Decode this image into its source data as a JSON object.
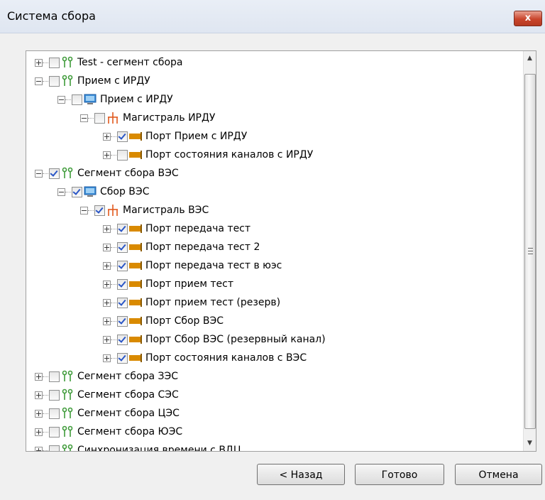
{
  "window": {
    "title": "Система сбора",
    "close_label": "x"
  },
  "tree": {
    "items": [
      {
        "label": "Test - сегмент сбора",
        "level": 0,
        "expander": "plus",
        "checked": false,
        "icon": "segment-icon"
      },
      {
        "label": "Прием с ИРДУ",
        "level": 0,
        "expander": "minus",
        "checked": false,
        "icon": "segment-icon"
      },
      {
        "label": "Прием с ИРДУ",
        "level": 1,
        "expander": "minus",
        "checked": false,
        "icon": "monitor-icon"
      },
      {
        "label": "Магистраль ИРДУ",
        "level": 2,
        "expander": "minus",
        "checked": false,
        "icon": "network-icon"
      },
      {
        "label": "Порт Прием с ИРДУ",
        "level": 3,
        "expander": "plus",
        "checked": true,
        "icon": "port-icon"
      },
      {
        "label": "Порт состояния каналов с ИРДУ",
        "level": 3,
        "expander": "plus",
        "checked": false,
        "icon": "port-icon"
      },
      {
        "label": "Сегмент сбора ВЭС",
        "level": 0,
        "expander": "minus",
        "checked": true,
        "icon": "segment-icon"
      },
      {
        "label": "Сбор ВЭС",
        "level": 1,
        "expander": "minus",
        "checked": true,
        "icon": "monitor-icon"
      },
      {
        "label": "Магистраль ВЭС",
        "level": 2,
        "expander": "minus",
        "checked": true,
        "icon": "network-icon"
      },
      {
        "label": "Порт передача тест",
        "level": 3,
        "expander": "plus",
        "checked": true,
        "icon": "port-icon"
      },
      {
        "label": "Порт передача тест 2",
        "level": 3,
        "expander": "plus",
        "checked": true,
        "icon": "port-icon"
      },
      {
        "label": "Порт передача тест в юэс",
        "level": 3,
        "expander": "plus",
        "checked": true,
        "icon": "port-icon"
      },
      {
        "label": "Порт прием тест",
        "level": 3,
        "expander": "plus",
        "checked": true,
        "icon": "port-icon"
      },
      {
        "label": "Порт прием тест (резерв)",
        "level": 3,
        "expander": "plus",
        "checked": true,
        "icon": "port-icon"
      },
      {
        "label": "Порт Сбор ВЭС",
        "level": 3,
        "expander": "plus",
        "checked": true,
        "icon": "port-icon"
      },
      {
        "label": "Порт Сбор ВЭС (резервный канал)",
        "level": 3,
        "expander": "plus",
        "checked": true,
        "icon": "port-icon"
      },
      {
        "label": "Порт состояния каналов с ВЭС",
        "level": 3,
        "expander": "plus",
        "checked": true,
        "icon": "port-icon"
      },
      {
        "label": "Сегмент сбора ЗЭС",
        "level": 0,
        "expander": "plus",
        "checked": false,
        "icon": "segment-icon"
      },
      {
        "label": "Сегмент сбора СЭС",
        "level": 0,
        "expander": "plus",
        "checked": false,
        "icon": "segment-icon"
      },
      {
        "label": "Сегмент сбора ЦЭС",
        "level": 0,
        "expander": "plus",
        "checked": false,
        "icon": "segment-icon"
      },
      {
        "label": "Сегмент сбора ЮЭС",
        "level": 0,
        "expander": "plus",
        "checked": false,
        "icon": "segment-icon"
      },
      {
        "label": "Синхронизация времени с ВДЦ",
        "level": 0,
        "expander": "plus",
        "checked": false,
        "icon": "segment-icon"
      }
    ]
  },
  "buttons": {
    "back": "< Назад",
    "finish": "Готово",
    "cancel": "Отмена"
  },
  "colors": {
    "check": "#2a56c6",
    "segment_icon": "#3f9b3a",
    "monitor_icon": "#3b8fd9",
    "network_icon": "#e1581d",
    "port_icon": "#d98a00"
  }
}
